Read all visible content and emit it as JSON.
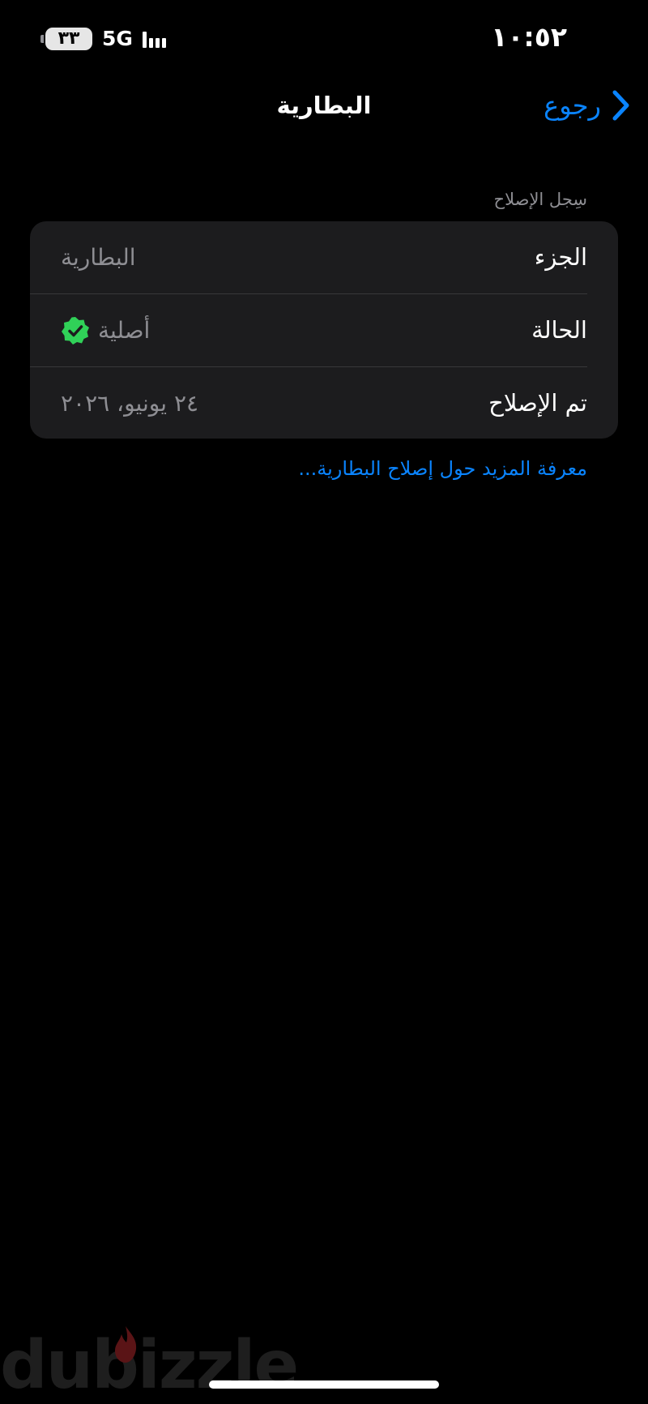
{
  "status_bar": {
    "time": "١٠:٥٢",
    "battery_level": "٣٣",
    "network": "5G",
    "signal_bars": 3
  },
  "nav": {
    "back_label": "رجوع",
    "title": "البطارية"
  },
  "section": {
    "header": "سِجل الإصلاح",
    "rows": [
      {
        "label": "الجزء",
        "value": "البطارية"
      },
      {
        "label": "الحالة",
        "value": "أصلية",
        "icon": "verified-checkmark-icon"
      },
      {
        "label": "تم الإصلاح",
        "value": "٢٤ يونيو، ٢٠٢٦"
      }
    ]
  },
  "more_link": "معرفة المزيد حول إصلاح البطارية...",
  "watermark": "dubizzle",
  "colors": {
    "background": "#000000",
    "card": "#1c1c1e",
    "accent_blue": "#0a84ff",
    "secondary_text": "#8e8e93",
    "verified_green": "#30d158",
    "watermark_flame": "#e0282e"
  }
}
